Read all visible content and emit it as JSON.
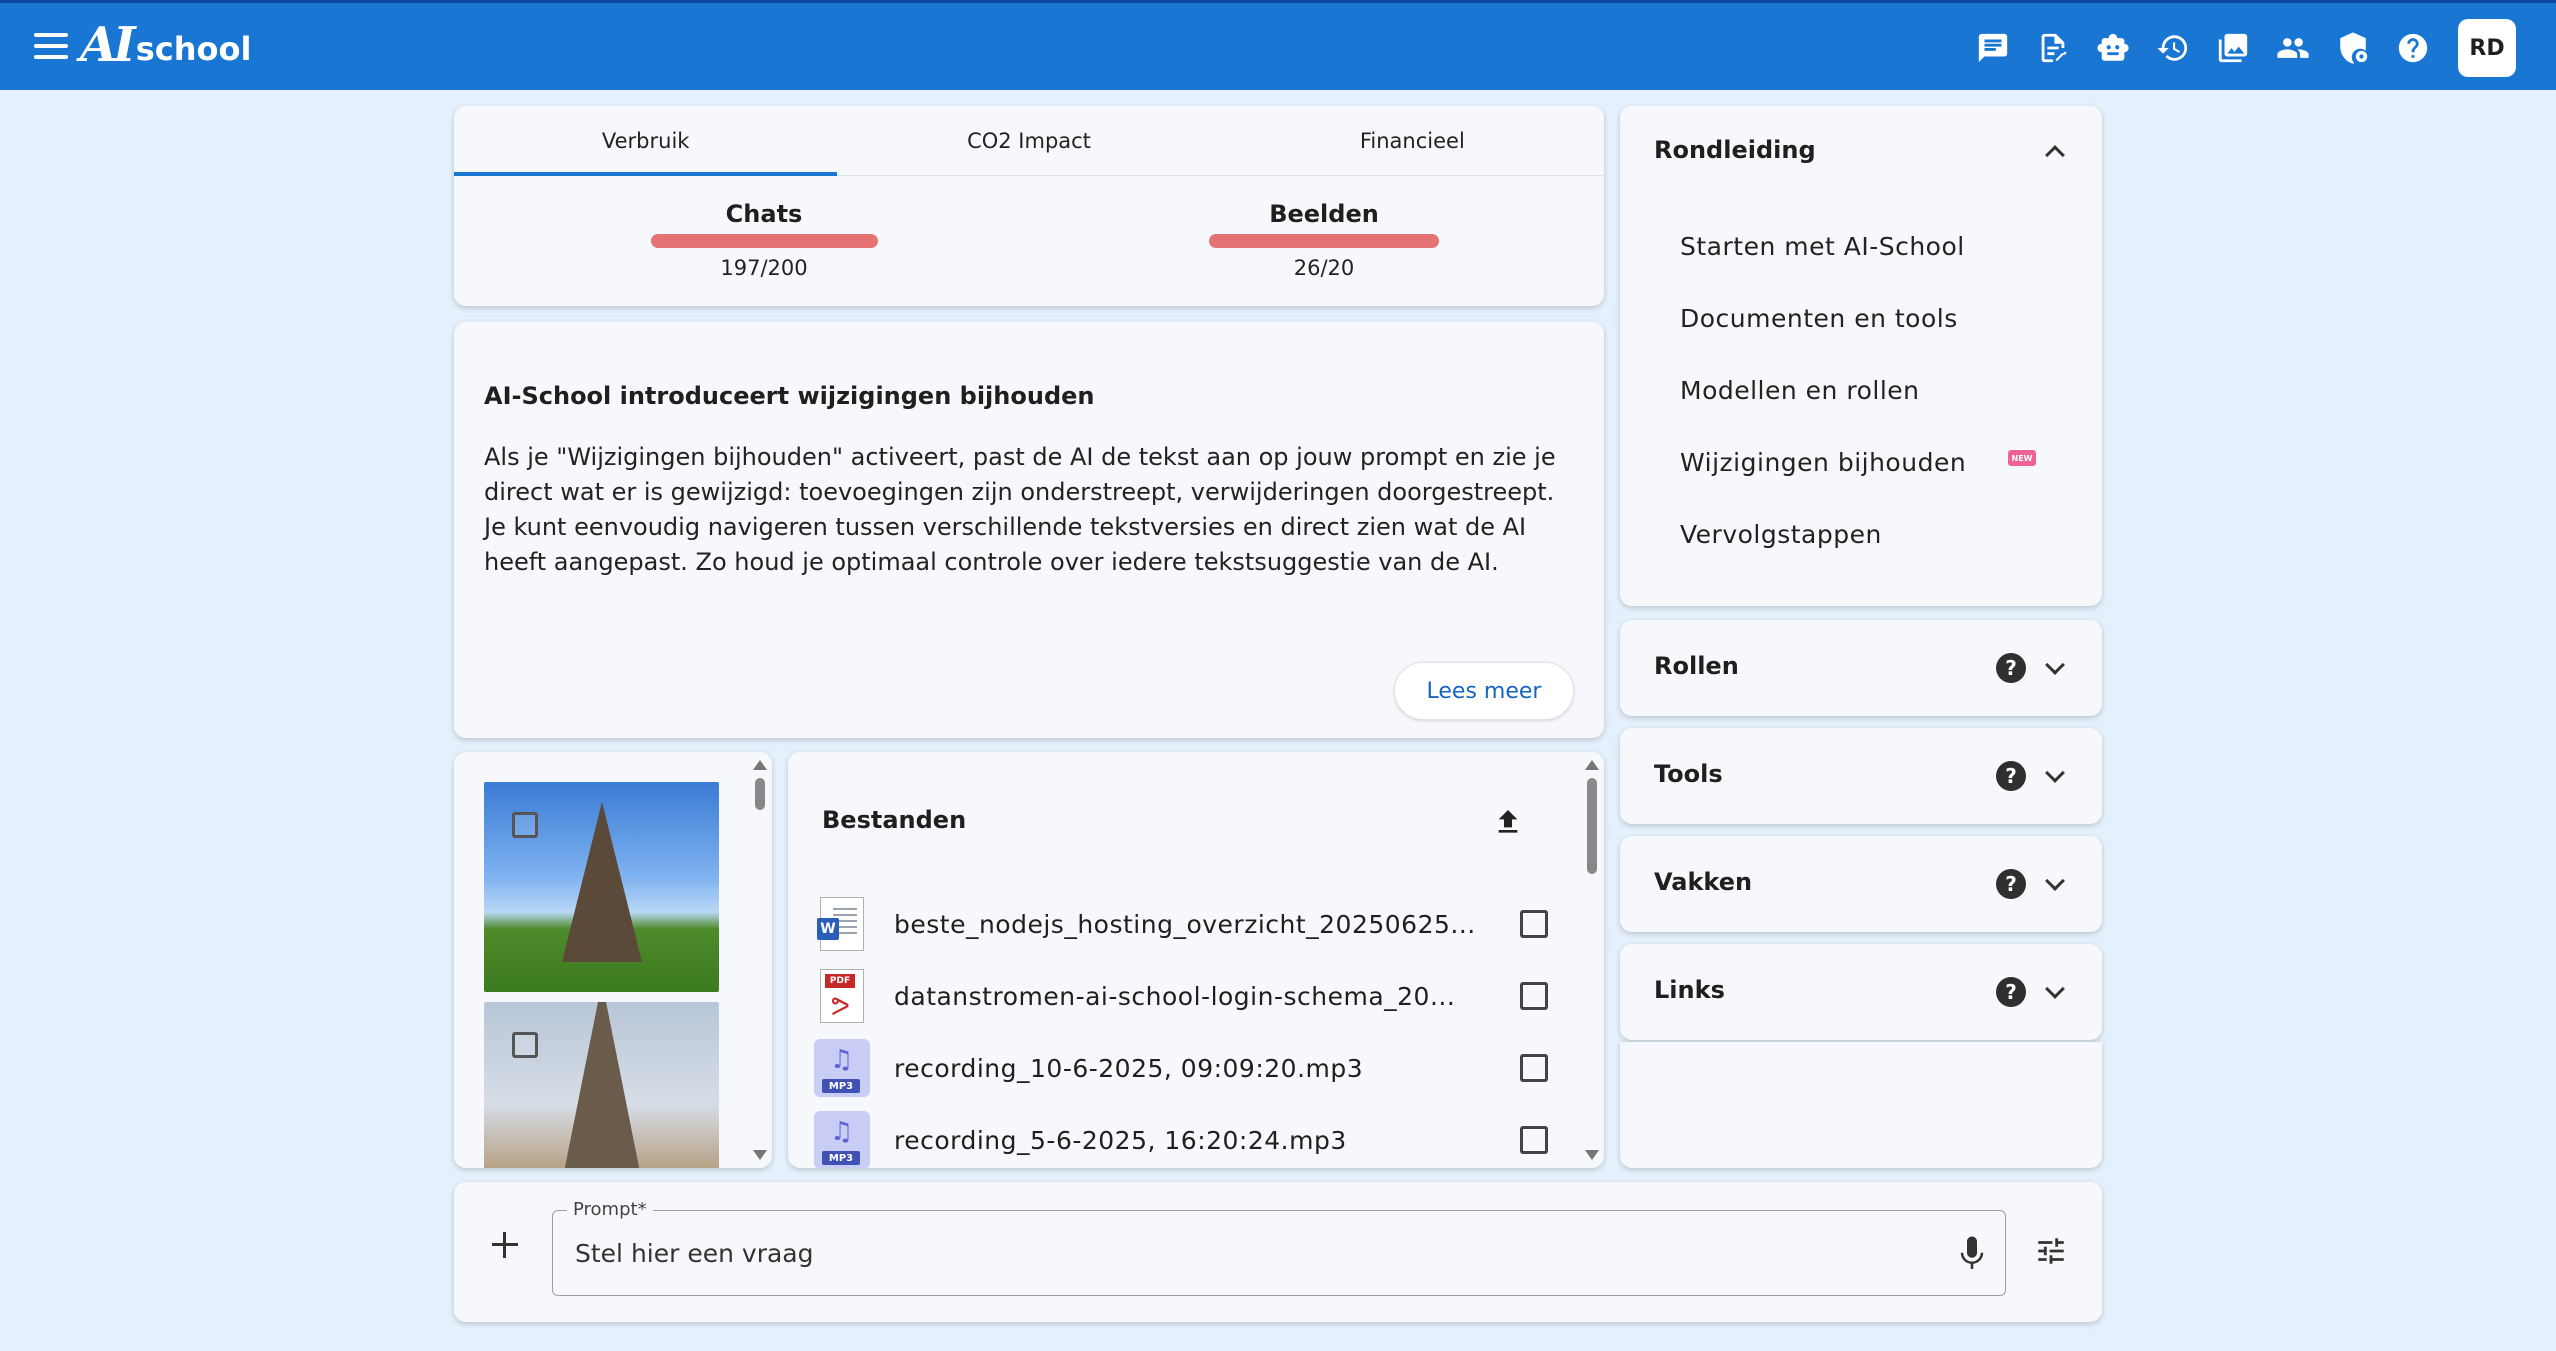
{
  "app": {
    "logo_mark": "AI",
    "logo_text": "school",
    "avatar_initials": "RD"
  },
  "top_icons": [
    "chat-icon",
    "document-edit-icon",
    "robot-icon",
    "history-icon",
    "images-icon",
    "group-icon",
    "shield-settings-icon",
    "help-icon"
  ],
  "usage": {
    "tabs": [
      {
        "label": "Verbruik",
        "active": true
      },
      {
        "label": "CO2 Impact",
        "active": false
      },
      {
        "label": "Financieel",
        "active": false
      }
    ],
    "meters": [
      {
        "title": "Chats",
        "count": "197/200",
        "fraction": 0.985
      },
      {
        "title": "Beelden",
        "count": "26/20",
        "fraction": 1.0
      }
    ],
    "bar_color": "#e57373"
  },
  "announcement": {
    "title": "AI-School introduceert wijzigingen bijhouden",
    "body": "Als je \"Wijzigingen bijhouden\" activeert, past de AI de tekst aan op jouw prompt en zie je direct wat er is gewijzigd: toevoegingen zijn onderstreept, verwijderingen doorgestreept. Je kunt eenvoudig navigeren tussen verschillende tekstversies en direct zien wat de AI heeft aangepast. Zo houd je optimaal controle over iedere tekstsuggestie van de AI.",
    "read_more": "Lees meer"
  },
  "files": {
    "title": "Bestanden",
    "items": [
      {
        "name": "beste_nodejs_hosting_overzicht_20250625...",
        "type": "word"
      },
      {
        "name": "datanstromen-ai-school-login-schema_20...",
        "type": "pdf"
      },
      {
        "name": "recording_10-6-2025, 09:09:20.mp3",
        "type": "mp3"
      },
      {
        "name": "recording_5-6-2025, 16:20:24.mp3",
        "type": "mp3"
      }
    ],
    "word_badge": "W",
    "pdf_badge": "PDF",
    "mp3_badge": "MP3"
  },
  "guide": {
    "title": "Rondleiding",
    "items": [
      {
        "label": "Starten met AI-School"
      },
      {
        "label": "Documenten en tools"
      },
      {
        "label": "Modellen en rollen"
      },
      {
        "label": "Wijzigingen bijhouden",
        "badge": "NEW"
      },
      {
        "label": "Vervolgstappen"
      }
    ]
  },
  "accordions": [
    {
      "title": "Rollen",
      "help": "?"
    },
    {
      "title": "Tools",
      "help": "?"
    },
    {
      "title": "Vakken",
      "help": "?"
    },
    {
      "title": "Links",
      "help": "?"
    }
  ],
  "prompt": {
    "label": "Prompt*",
    "placeholder": "Stel hier een vraag"
  },
  "colors": {
    "primary": "#1976d2",
    "background": "#e4f0fb",
    "card": "#f7f8fb",
    "badge_new": "#f06292"
  }
}
